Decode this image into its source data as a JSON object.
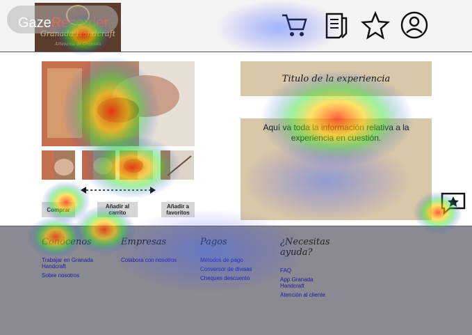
{
  "overlay": {
    "recorder_brand_a": "Gaze",
    "recorder_brand_b": "Recorder"
  },
  "header": {
    "logo_name": "Granada Handcraft",
    "logo_tagline": "Artesanía de Granada",
    "icons": [
      "cart-icon",
      "receipt-icon",
      "star-icon",
      "user-icon"
    ]
  },
  "main": {
    "title": "Titulo de la experiencia",
    "info": "Aquí va toda la información relativa a la experiencia en cuestión.",
    "buttons": {
      "buy": "Comprar",
      "add_cart": "Añadir al carrito",
      "add_fav": "Añadir a favoritos"
    }
  },
  "footer": {
    "col1": {
      "title": "Conócenos",
      "links": [
        "Trabajar en Granada Handcraft",
        "Sobre nosotros"
      ]
    },
    "col2": {
      "title": "Empresas",
      "links": [
        "Colabora con nosotros"
      ]
    },
    "col3": {
      "title": "Pagos",
      "links": [
        "Métodos de pago",
        "Conversor de divisas",
        "Cheques descuento"
      ]
    },
    "col4": {
      "title": "¿Necesitas ayuda?",
      "links": [
        "FAQ",
        "App Granada Handcraft",
        "Atención al cliente"
      ]
    }
  },
  "colors": {
    "footer_bg": "#8a8a92",
    "panel": "#d8c7a8",
    "link": "#1a1aa0"
  }
}
